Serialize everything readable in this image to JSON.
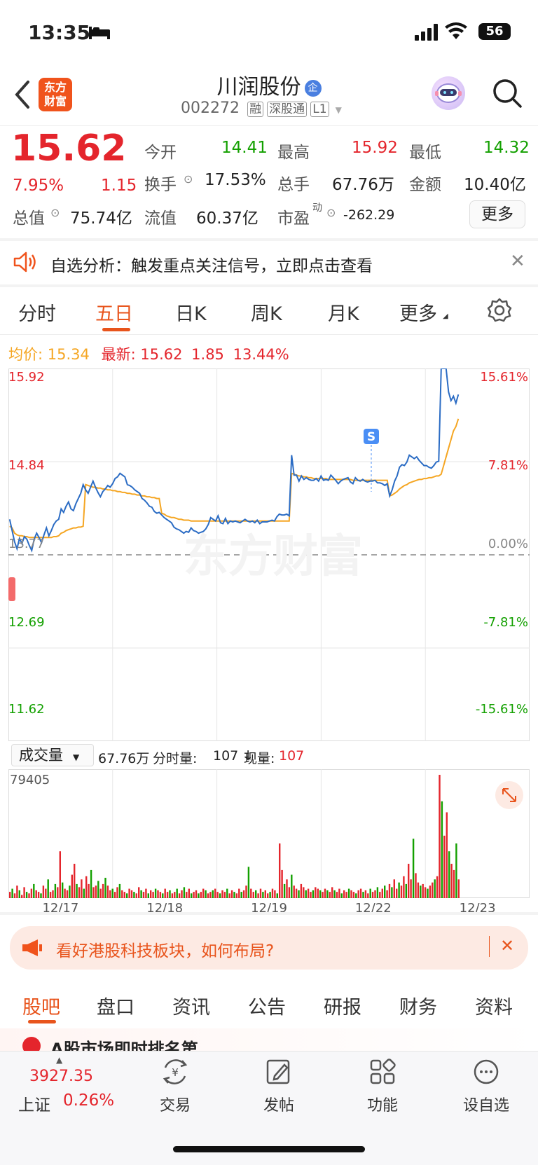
{
  "status": {
    "time": "13:35",
    "battery": "56"
  },
  "header": {
    "logo_line1": "东方",
    "logo_line2": "财富",
    "name": "川润股份",
    "name_badge": "企",
    "code": "002272",
    "tags": [
      "融",
      "深股通",
      "L1"
    ]
  },
  "quote": {
    "price": "15.62",
    "change_pct": "7.95%",
    "change": "1.15",
    "open_label": "今开",
    "open": "14.41",
    "high_label": "最高",
    "high": "15.92",
    "low_label": "最低",
    "low": "14.32",
    "turnover_label": "换手",
    "turnover": "17.53%",
    "volume_label": "总手",
    "volume": "67.76万",
    "amount_label": "金额",
    "amount": "10.40亿",
    "total_cap_label": "总值",
    "total_cap": "75.74亿",
    "float_cap_label": "流值",
    "float_cap": "60.37亿",
    "pe_label": "市盈",
    "pe_sup": "动",
    "pe": "-262.29",
    "more_button": "更多"
  },
  "banner": {
    "text": "自选分析：触发重点关注信号，立即点击查看"
  },
  "chart_tabs": [
    "分时",
    "五日",
    "日K",
    "周K",
    "月K",
    "更多"
  ],
  "active_tab": "五日",
  "legend": {
    "avg_label": "均价:",
    "avg": "15.34",
    "latest_label": "最新:",
    "latest": "15.62",
    "chg": "1.85",
    "pct": "13.44%"
  },
  "vol_bar": {
    "select": "成交量",
    "total": "67.76万",
    "tick_label": "分时量:",
    "tick": "107 ↓",
    "now_label": "现量:",
    "now": "107",
    "max": "79405"
  },
  "promo": {
    "text": "看好港股科技板块，如何布局?"
  },
  "bottom_tabs": [
    "股吧",
    "盘口",
    "资讯",
    "公告",
    "研报",
    "财务",
    "资料"
  ],
  "teaser": "A股市场即时排名第",
  "index": {
    "value": "3927.35",
    "name": "上证",
    "pct": "0.26%"
  },
  "nav": [
    "交易",
    "发帖",
    "功能",
    "设自选"
  ],
  "chart_data": {
    "type": "line",
    "title": "",
    "x_dates": [
      "12/17",
      "12/18",
      "12/19",
      "12/22",
      "12/23"
    ],
    "y_left_ticks": [
      "15.92",
      "14.84",
      "13.77",
      "12.69",
      "11.62"
    ],
    "y_right_ticks": [
      "15.61%",
      "7.81%",
      "0.00%",
      "-7.81%",
      "-15.61%"
    ],
    "ylim": [
      11.62,
      15.92
    ],
    "prev_close": 13.77,
    "series": [
      {
        "name": "价格",
        "color": "#2b6cc4",
        "values": [
          14.18,
          14.05,
          13.92,
          13.84,
          13.96,
          13.9,
          13.98,
          13.95,
          13.88,
          13.82,
          13.95,
          14.02,
          13.97,
          13.91,
          14.0,
          14.08,
          13.99,
          14.05,
          14.12,
          14.16,
          14.18,
          14.3,
          14.26,
          14.33,
          14.38,
          14.3,
          14.28,
          14.36,
          14.42,
          14.48,
          14.58,
          14.52,
          14.48,
          14.55,
          14.62,
          14.55,
          14.49,
          14.44,
          14.5,
          14.53,
          14.57,
          14.55,
          14.59,
          14.65,
          14.67,
          14.71,
          14.69,
          14.67,
          14.58,
          14.57,
          14.55,
          14.52,
          14.5,
          14.48,
          14.42,
          14.4,
          14.37,
          14.33,
          14.32,
          14.27,
          14.25,
          14.26,
          14.23,
          14.2,
          14.18,
          14.16,
          14.14,
          14.09,
          14.07,
          14.06,
          14.04,
          14.02,
          14.04,
          14.03,
          14.08,
          14.05,
          14.04,
          14.02,
          14.03,
          14.04,
          14.07,
          14.12,
          14.2,
          14.18,
          14.16,
          14.22,
          14.14,
          14.13,
          14.19,
          14.13,
          14.16,
          14.15,
          14.16,
          14.15,
          14.14,
          14.16,
          14.18,
          14.16,
          14.15,
          14.16,
          14.14,
          14.17,
          14.13,
          14.15,
          14.15,
          14.15,
          14.16,
          14.17,
          14.16,
          14.21,
          14.24,
          14.23,
          14.23,
          14.24,
          14.22,
          14.92,
          14.69,
          14.69,
          14.62,
          14.68,
          14.64,
          14.66,
          14.64,
          14.63,
          14.63,
          14.65,
          14.62,
          14.68,
          14.63,
          14.64,
          14.63,
          14.69,
          14.66,
          14.63,
          14.59,
          14.62,
          14.64,
          14.65,
          14.66,
          14.61,
          14.59,
          14.66,
          14.63,
          14.62,
          14.64,
          14.62,
          14.61,
          14.62,
          14.62,
          14.63,
          14.6,
          14.6,
          14.59,
          14.57,
          14.59,
          14.45,
          14.52,
          14.62,
          14.68,
          14.78,
          14.81,
          14.8,
          14.84,
          14.92,
          14.9,
          14.88,
          14.9,
          14.86,
          14.83,
          14.8,
          14.8,
          14.78,
          14.77,
          14.8,
          14.84,
          14.85,
          15.92,
          15.92,
          15.92,
          15.65,
          15.55,
          15.6,
          15.52,
          15.62
        ]
      },
      {
        "name": "均价",
        "color": "#f5a623",
        "values": [
          14.1,
          14.08,
          14.02,
          14.0,
          13.99,
          13.99,
          13.98,
          13.98,
          13.97,
          13.97,
          13.97,
          13.97,
          13.97,
          13.97,
          13.97,
          13.97,
          13.97,
          13.97,
          13.98,
          13.98,
          13.99,
          14.02,
          14.03,
          14.05,
          14.06,
          14.07,
          14.08,
          14.08,
          14.09,
          14.09,
          14.1,
          14.58,
          14.57,
          14.56,
          14.55,
          14.55,
          14.54,
          14.54,
          14.53,
          14.53,
          14.52,
          14.52,
          14.51,
          14.51,
          14.5,
          14.5,
          14.49,
          14.49,
          14.48,
          14.48,
          14.47,
          14.47,
          14.46,
          14.46,
          14.45,
          14.45,
          14.44,
          14.44,
          14.43,
          14.43,
          14.42,
          14.42,
          14.25,
          14.24,
          14.22,
          14.21,
          14.2,
          14.2,
          14.19,
          14.18,
          14.18,
          14.17,
          14.17,
          14.17,
          14.16,
          14.16,
          14.16,
          14.16,
          14.16,
          14.16,
          14.16,
          14.16,
          14.16,
          14.16,
          14.16,
          14.16,
          14.16,
          14.16,
          14.16,
          14.16,
          14.16,
          14.16,
          14.16,
          14.16,
          14.16,
          14.16,
          14.16,
          14.16,
          14.16,
          14.16,
          14.16,
          14.16,
          14.16,
          14.16,
          14.16,
          14.16,
          14.16,
          14.16,
          14.16,
          14.16,
          14.16,
          14.16,
          14.16,
          14.16,
          14.16,
          14.71,
          14.7,
          14.69,
          14.68,
          14.68,
          14.67,
          14.67,
          14.66,
          14.66,
          14.65,
          14.65,
          14.65,
          14.65,
          14.65,
          14.65,
          14.64,
          14.64,
          14.64,
          14.64,
          14.64,
          14.64,
          14.64,
          14.64,
          14.64,
          14.64,
          14.63,
          14.63,
          14.63,
          14.63,
          14.63,
          14.63,
          14.63,
          14.63,
          14.63,
          14.63,
          14.63,
          14.63,
          14.63,
          14.63,
          14.63,
          14.45,
          14.46,
          14.48,
          14.5,
          14.53,
          14.55,
          14.57,
          14.58,
          14.6,
          14.61,
          14.62,
          14.63,
          14.64,
          14.64,
          14.65,
          14.65,
          14.66,
          14.66,
          14.67,
          14.68,
          14.68,
          14.7,
          14.8,
          14.9,
          15.0,
          15.1,
          15.2,
          15.25,
          15.34
        ]
      }
    ],
    "volume_values": [
      4,
      6,
      3,
      8,
      5,
      2,
      7,
      4,
      3,
      6,
      9,
      5,
      4,
      3,
      8,
      6,
      12,
      4,
      5,
      9,
      7,
      30,
      10,
      6,
      5,
      8,
      15,
      22,
      9,
      7,
      12,
      6,
      14,
      9,
      18,
      7,
      8,
      11,
      6,
      9,
      13,
      8,
      5,
      6,
      4,
      7,
      9,
      5,
      4,
      3,
      6,
      5,
      4,
      3,
      7,
      5,
      4,
      6,
      3,
      5,
      4,
      6,
      5,
      4,
      3,
      6,
      4,
      5,
      3,
      4,
      6,
      3,
      5,
      7,
      4,
      6,
      3,
      4,
      5,
      3,
      4,
      6,
      5,
      3,
      4,
      5,
      6,
      4,
      3,
      5,
      4,
      6,
      3,
      5,
      4,
      3,
      6,
      4,
      5,
      8,
      20,
      6,
      4,
      5,
      3,
      6,
      4,
      5,
      3,
      4,
      6,
      5,
      3,
      35,
      18,
      9,
      12,
      7,
      15,
      8,
      6,
      5,
      9,
      7,
      5,
      6,
      4,
      5,
      7,
      6,
      5,
      4,
      6,
      5,
      4,
      7,
      5,
      4,
      6,
      3,
      5,
      4,
      6,
      5,
      4,
      3,
      5,
      6,
      4,
      5,
      3,
      6,
      4,
      5,
      7,
      4,
      6,
      8,
      5,
      9,
      7,
      12,
      6,
      10,
      8,
      14,
      9,
      22,
      12,
      38,
      16,
      10,
      8,
      9,
      7,
      6,
      8,
      10,
      12,
      14,
      79,
      62,
      40,
      55,
      30,
      22,
      18,
      35,
      12
    ]
  }
}
